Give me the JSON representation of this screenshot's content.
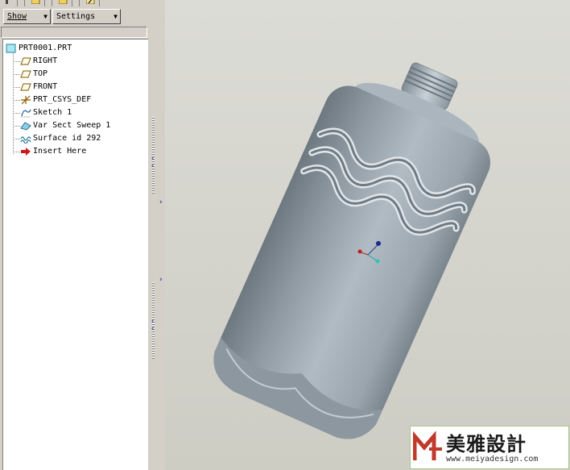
{
  "toolbar": {
    "show_label": "Show",
    "settings_label": "Settings"
  },
  "tree": {
    "root": "PRT0001.PRT",
    "items": [
      {
        "label": "RIGHT",
        "icon": "datum-plane-icon"
      },
      {
        "label": "TOP",
        "icon": "datum-plane-icon"
      },
      {
        "label": "FRONT",
        "icon": "datum-plane-icon"
      },
      {
        "label": "PRT_CSYS_DEF",
        "icon": "coordinate-system-icon"
      },
      {
        "label": "Sketch 1",
        "icon": "sketch-icon"
      },
      {
        "label": "Var Sect Sweep 1",
        "icon": "sweep-icon"
      },
      {
        "label": "Surface id 292",
        "icon": "surface-icon"
      },
      {
        "label": "Insert Here",
        "icon": "insert-arrow-icon"
      }
    ]
  },
  "watermark": {
    "title": "美雅設計",
    "url": "www.meiyadesign.com"
  },
  "colors": {
    "model": "#a9b4bd",
    "panel": "#d4d0c8",
    "tree_bg": "#ffffff",
    "watermark_border": "#a9c389",
    "watermark_logo": "#c0392b"
  }
}
